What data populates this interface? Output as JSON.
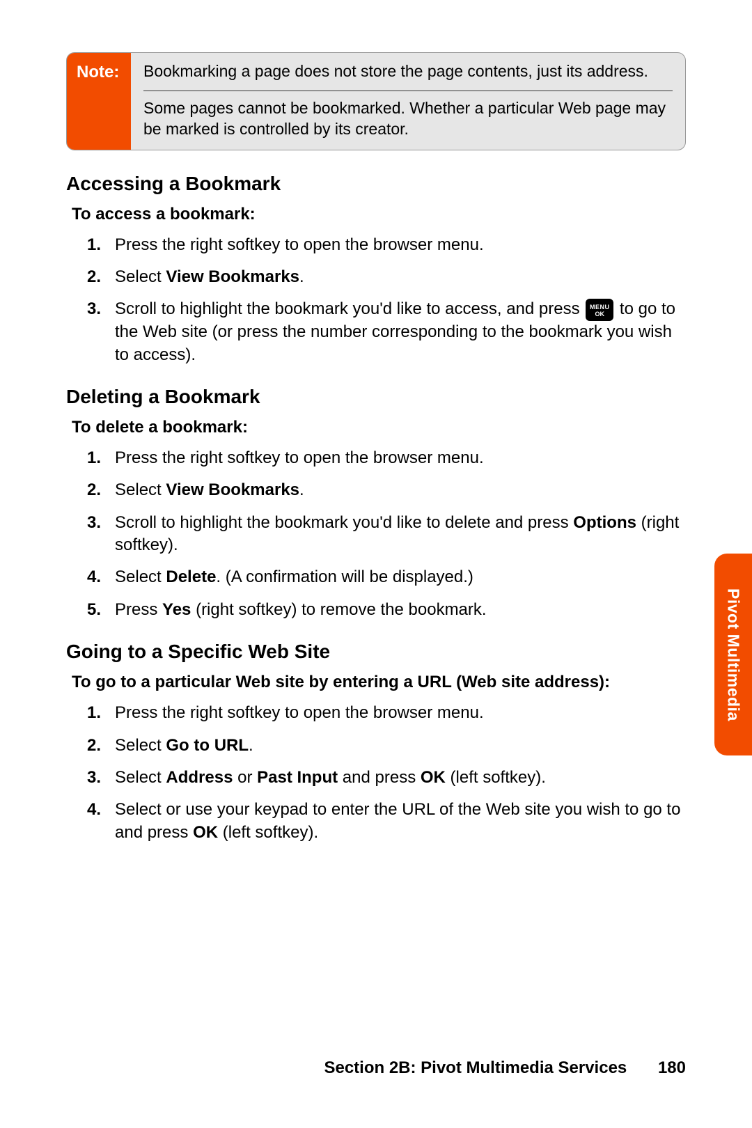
{
  "note": {
    "label": "Note:",
    "line1": "Bookmarking a page does not store the page contents, just its address.",
    "line2": "Some pages cannot be bookmarked. Whether a particular Web page may be marked is controlled by its creator."
  },
  "sections": {
    "accessing": {
      "heading": "Accessing a Bookmark",
      "sub": "To access a bookmark:",
      "steps": {
        "s1": "Press the right softkey to open the browser menu.",
        "s2_pre": "Select ",
        "s2_bold": "View Bookmarks",
        "s2_post": ".",
        "s3_pre": "Scroll to highlight the bookmark you'd like to access, and press ",
        "s3_post": " to go to the Web site (or press the number corresponding to the bookmark you wish to access)."
      }
    },
    "deleting": {
      "heading": "Deleting a Bookmark",
      "sub": "To delete a bookmark:",
      "steps": {
        "s1": "Press the right softkey to open the browser menu.",
        "s2_pre": "Select ",
        "s2_bold": "View Bookmarks",
        "s2_post": ".",
        "s3_pre": "Scroll to highlight the bookmark you'd like to delete and press ",
        "s3_bold": "Options",
        "s3_post": " (right softkey).",
        "s4_pre": "Select ",
        "s4_bold": "Delete",
        "s4_post": ". (A confirmation will be displayed.)",
        "s5_pre": "Press ",
        "s5_bold": "Yes",
        "s5_post": " (right softkey) to remove the bookmark."
      }
    },
    "going": {
      "heading": "Going to a Specific Web Site",
      "sub": "To go to a particular Web site by entering a URL (Web site address):",
      "steps": {
        "s1": "Press the right softkey to open the browser menu.",
        "s2_pre": "Select ",
        "s2_bold": "Go to URL",
        "s2_post": ".",
        "s3_pre": "Select ",
        "s3_bold1": "Address",
        "s3_mid": " or ",
        "s3_bold2": "Past Input",
        "s3_mid2": " and press ",
        "s3_bold3": "OK",
        "s3_post": " (left softkey).",
        "s4_pre": "Select or use your keypad to enter the URL of the Web site you wish to go to and press ",
        "s4_bold": "OK",
        "s4_post": " (left softkey)."
      }
    }
  },
  "icon": {
    "line1": "MENU",
    "line2": "OK"
  },
  "sideTab": "Pivot Multimedia",
  "footer": {
    "section": "Section 2B: Pivot Multimedia Services",
    "page": "180"
  }
}
